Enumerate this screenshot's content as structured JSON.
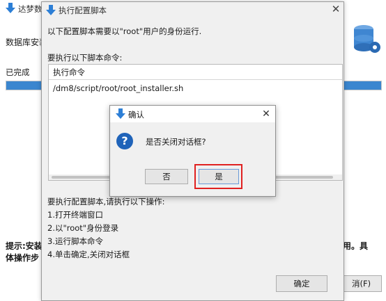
{
  "background_window": {
    "title": "达梦数",
    "heading": "数据库安装",
    "status": "已完成",
    "progress": 1.0,
    "hint_line1": "提示:安装",
    "hint_line2": "体操作步",
    "hint_right": "用。具",
    "cancel_fragment": "消(F)"
  },
  "script_dialog": {
    "title": "执行配置脚本",
    "note": "以下配置脚本需要以\"root\"用户的身份运行.",
    "commands_label": "要执行以下脚本命令:",
    "table_header": "执行命令",
    "commands": [
      "/dm8/script/root/root_installer.sh"
    ],
    "steps_label": "要执行配置脚本,请执行以下操作:",
    "steps": [
      "1.打开终端窗口",
      "2.以\"root\"身份登录",
      "3.运行脚本命令",
      "4.单击确定,关闭对话框"
    ],
    "ok_label": "确定",
    "close_glyph": "✕"
  },
  "confirm_dialog": {
    "title": "确认",
    "message": "是否关闭对话框?",
    "no_label": "否",
    "yes_label": "是",
    "close_glyph": "✕",
    "icon_glyph": "?"
  },
  "colors": {
    "accent": "#1f63b9",
    "highlight": "#e02020",
    "progress": "#3b86cf"
  }
}
